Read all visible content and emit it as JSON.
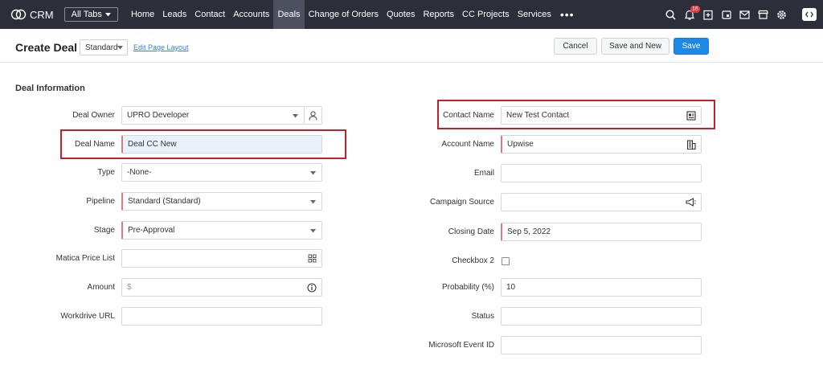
{
  "nav": {
    "app_name": "CRM",
    "all_tabs_label": "All Tabs",
    "links": [
      {
        "label": "Home",
        "active": false
      },
      {
        "label": "Leads",
        "active": false
      },
      {
        "label": "Contact",
        "active": false
      },
      {
        "label": "Accounts",
        "active": false
      },
      {
        "label": "Deals",
        "active": true
      },
      {
        "label": "Change of Orders",
        "active": false
      },
      {
        "label": "Quotes",
        "active": false
      },
      {
        "label": "Reports",
        "active": false
      },
      {
        "label": "CC Projects",
        "active": false
      },
      {
        "label": "Services",
        "active": false
      }
    ],
    "more_label": "•••",
    "notification_count": "16",
    "icons": [
      "search-icon",
      "bell-icon",
      "add-note-icon",
      "calendar-icon",
      "mail-icon",
      "store-icon",
      "gear-icon",
      "zoho-apps-icon"
    ]
  },
  "header": {
    "title": "Create Deal",
    "layout_value": "Standard",
    "edit_layout_label": "Edit Page Layout",
    "cancel_label": "Cancel",
    "save_new_label": "Save and New",
    "save_label": "Save"
  },
  "section": {
    "title": "Deal Information"
  },
  "left_fields": {
    "deal_owner": {
      "label": "Deal Owner",
      "value": "UPRO Developer"
    },
    "deal_name": {
      "label": "Deal Name",
      "value": "Deal CC New"
    },
    "type": {
      "label": "Type",
      "value": "-None-"
    },
    "pipeline": {
      "label": "Pipeline",
      "value": "Standard (Standard)"
    },
    "stage": {
      "label": "Stage",
      "value": "Pre-Approval"
    },
    "matica_price_list": {
      "label": "Matica Price List",
      "value": ""
    },
    "amount": {
      "label": "Amount",
      "placeholder": "$"
    },
    "workdrive_url": {
      "label": "Workdrive URL",
      "value": ""
    }
  },
  "right_fields": {
    "contact_name": {
      "label": "Contact Name",
      "value": "New Test Contact"
    },
    "account_name": {
      "label": "Account Name",
      "value": "Upwise"
    },
    "email": {
      "label": "Email",
      "value": ""
    },
    "campaign_source": {
      "label": "Campaign Source",
      "value": ""
    },
    "closing_date": {
      "label": "Closing Date",
      "value": "Sep 5, 2022"
    },
    "checkbox_2": {
      "label": "Checkbox 2",
      "checked": false
    },
    "probability": {
      "label": "Probability (%)",
      "value": "10"
    },
    "status": {
      "label": "Status",
      "value": ""
    },
    "microsoft_event_id": {
      "label": "Microsoft Event ID",
      "value": ""
    }
  },
  "colors": {
    "nav_bg": "#2c2f3a",
    "nav_active": "#4d515f",
    "save_button": "#1e88e5",
    "highlight_box": "#c8202b",
    "required_marker": "#e27a7a",
    "badge": "#e2363b"
  }
}
